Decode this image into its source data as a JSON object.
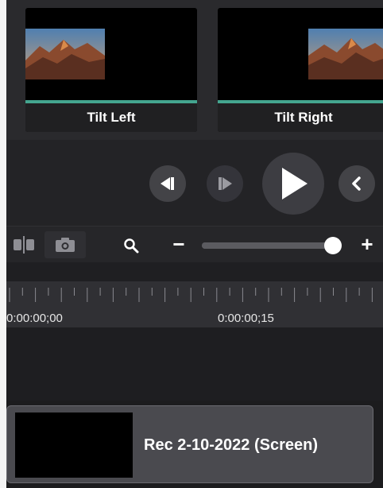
{
  "transitions": {
    "items": [
      {
        "label": "Tilt Left"
      },
      {
        "label": "Tilt Right"
      }
    ],
    "accent_color": "#44a58f"
  },
  "playback": {
    "icons": [
      "step-back-icon",
      "step-forward-icon",
      "play-icon",
      "previous-icon"
    ]
  },
  "toolbar": {
    "icons": [
      "split-icon",
      "camera-icon",
      "zoom-icon"
    ],
    "zoom_minus": "−",
    "zoom_plus": "+",
    "zoom_level": 0.96
  },
  "timeline": {
    "timecodes": [
      "0:00:00;00",
      "0:00:00;15"
    ]
  },
  "clip": {
    "title": "Rec 2-10-2022 (Screen)"
  }
}
